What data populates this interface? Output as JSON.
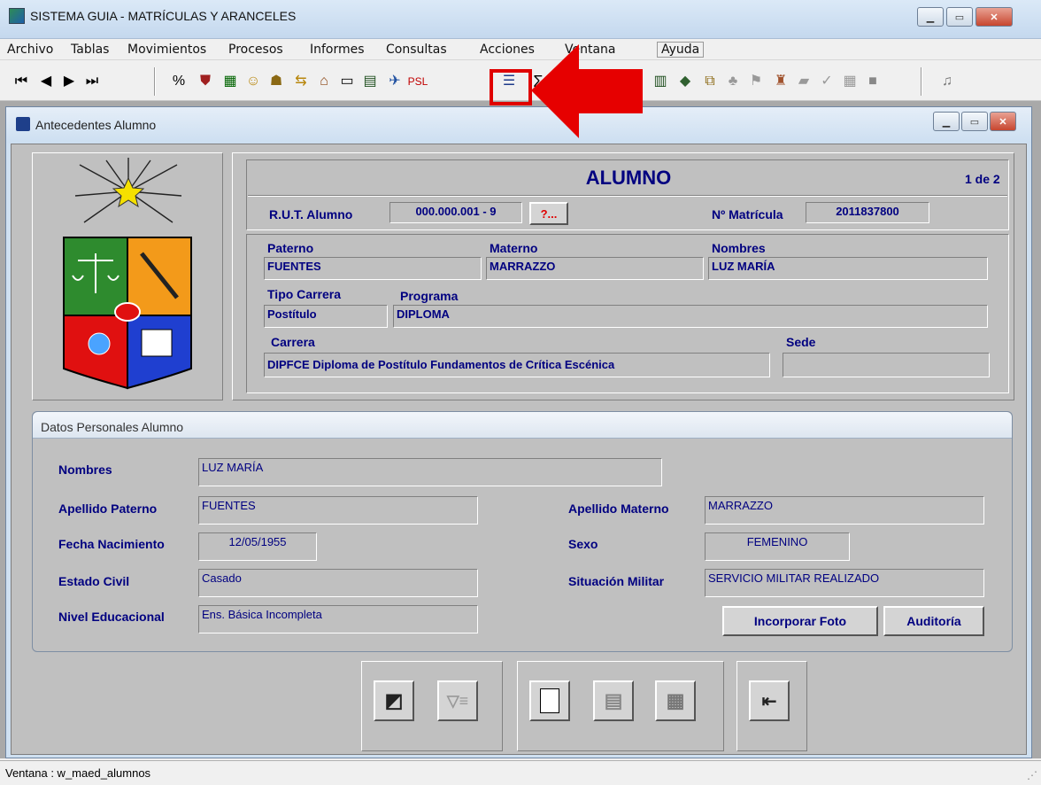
{
  "app": {
    "title": "SISTEMA GUIA - MATRÍCULAS Y ARANCELES"
  },
  "menu": [
    "Archivo",
    "Tablas",
    "Movimientos",
    "Procesos",
    "Informes",
    "Consultas",
    "Acciones",
    "Ventana",
    "Ayuda"
  ],
  "toolbar": {
    "psl_label": "PSL",
    "sigma_label": "Σ"
  },
  "child": {
    "title": "Antecedentes Alumno"
  },
  "header": {
    "title": "ALUMNO",
    "record_counter": "1 de 2",
    "rut_label": "R.U.T. Alumno",
    "rut_value": "000.000.001 - 9",
    "rut_lookup": "?...",
    "matricula_label": "Nº Matrícula",
    "matricula_value": "2011837800",
    "paterno_label": "Paterno",
    "paterno_value": "FUENTES",
    "materno_label": "Materno",
    "materno_value": "MARRAZZO",
    "nombres_label": "Nombres",
    "nombres_value": "LUZ MARÍA",
    "tipo_carrera_label": "Tipo Carrera",
    "tipo_carrera_value": "Postítulo",
    "programa_label": "Programa",
    "programa_value": "DIPLOMA",
    "carrera_label": "Carrera",
    "carrera_value": "DIPFCE  Diploma de Postítulo Fundamentos de Crítica Escénica",
    "sede_label": "Sede",
    "sede_value": ""
  },
  "personal": {
    "section_title": "Datos Personales Alumno",
    "nombres_label": "Nombres",
    "nombres_value": "LUZ MARÍA",
    "ap_paterno_label": "Apellido Paterno",
    "ap_paterno_value": "FUENTES",
    "ap_materno_label": "Apellido Materno",
    "ap_materno_value": "MARRAZZO",
    "fecha_nac_label": "Fecha Nacimiento",
    "fecha_nac_value": "12/05/1955",
    "sexo_label": "Sexo",
    "sexo_value": "FEMENINO",
    "estado_civil_label": "Estado Civil",
    "estado_civil_value": "Casado",
    "sit_militar_label": "Situación Militar",
    "sit_militar_value": "SERVICIO MILITAR REALIZADO",
    "nivel_edu_label": "Nivel Educacional",
    "nivel_edu_value": "Ens. Básica Incompleta",
    "btn_foto": "Incorporar Foto",
    "btn_auditoria": "Auditoría"
  },
  "status": {
    "text": "Ventana : w_maed_alumnos"
  },
  "colors": {
    "highlight": "#e00000",
    "label_blue": "#000080",
    "form_bg": "#c0c0c0"
  }
}
